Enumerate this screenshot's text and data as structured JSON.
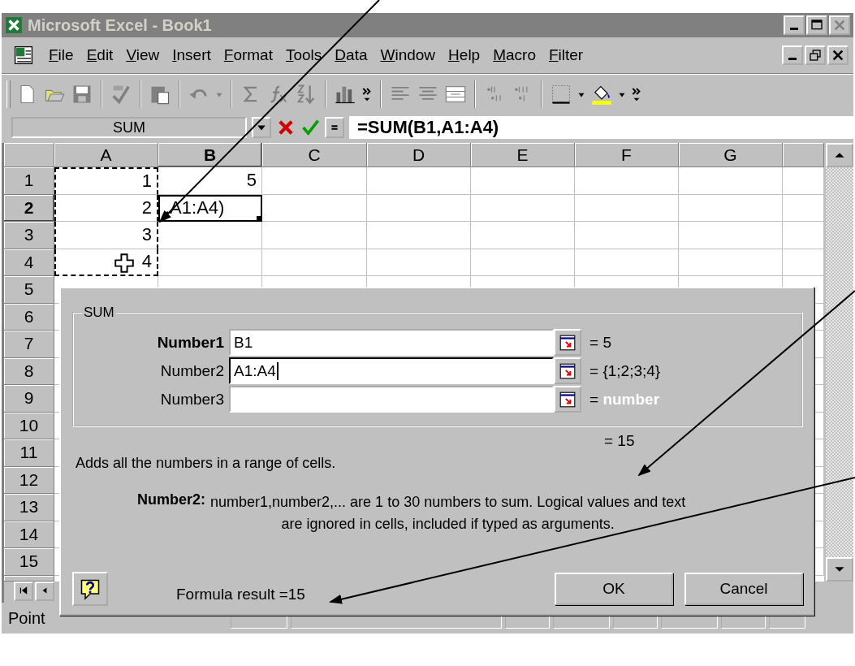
{
  "window": {
    "title": "Microsoft Excel - Book1"
  },
  "menu": [
    {
      "label": "File"
    },
    {
      "label": "Edit"
    },
    {
      "label": "View"
    },
    {
      "label": "Insert"
    },
    {
      "label": "Format"
    },
    {
      "label": "Tools"
    },
    {
      "label": "Data"
    },
    {
      "label": "Window"
    },
    {
      "label": "Help"
    },
    {
      "label": "Macro"
    },
    {
      "label": "Filter"
    }
  ],
  "formula_bar": {
    "name_box": "SUM",
    "formula": "=SUM(B1,A1:A4)"
  },
  "columns": [
    {
      "label": "A",
      "selected": false
    },
    {
      "label": "B",
      "selected": true
    },
    {
      "label": "C",
      "selected": false
    },
    {
      "label": "D",
      "selected": false
    },
    {
      "label": "E",
      "selected": false
    },
    {
      "label": "F",
      "selected": false
    },
    {
      "label": "G",
      "selected": false
    }
  ],
  "rows": [
    {
      "label": "1",
      "selected": false,
      "cells": [
        {
          "value": "1",
          "referenced": true
        },
        {
          "value": "5",
          "referenced": false
        }
      ]
    },
    {
      "label": "2",
      "selected": true,
      "cells": [
        {
          "value": "2",
          "referenced": true
        },
        {
          "value": ",A1:A4)",
          "referenced": false,
          "editing": true
        }
      ]
    },
    {
      "label": "3",
      "selected": false,
      "cells": [
        {
          "value": "3",
          "referenced": true
        }
      ]
    },
    {
      "label": "4",
      "selected": false,
      "cells": [
        {
          "value": "4",
          "referenced": true,
          "cursor": true
        }
      ]
    },
    {
      "label": "5",
      "selected": false
    },
    {
      "label": "6",
      "selected": false
    },
    {
      "label": "7",
      "selected": false
    },
    {
      "label": "8",
      "selected": false
    },
    {
      "label": "9",
      "selected": false
    },
    {
      "label": "10",
      "selected": false
    },
    {
      "label": "11",
      "selected": false
    },
    {
      "label": "12",
      "selected": false
    },
    {
      "label": "13",
      "selected": false
    },
    {
      "label": "14",
      "selected": false
    },
    {
      "label": "15",
      "selected": false
    }
  ],
  "dialog": {
    "group": "SUM",
    "arguments": [
      {
        "label": "Number1",
        "required": true,
        "value": "B1",
        "focused": false,
        "sign": "=",
        "result": "5",
        "hint": false
      },
      {
        "label": "Number2",
        "required": false,
        "value": "A1:A4",
        "focused": true,
        "sign": "=",
        "result": "{1;2;3;4}",
        "hint": false
      },
      {
        "label": "Number3",
        "required": false,
        "focused": false,
        "sign": "=",
        "result": "number",
        "hint": true
      }
    ],
    "total": "= 15",
    "description": "Adds all the numbers in a range of cells.",
    "help_label": "Number2:",
    "help_lines": [
      "number1,number2,... are 1 to 30 numbers to sum. Logical values and text",
      "are ignored in cells, included if typed as arguments."
    ],
    "formula_result": "Formula result =15",
    "buttons": [
      "OK",
      "Cancel"
    ]
  },
  "status_bar": {
    "mode": "Point"
  }
}
